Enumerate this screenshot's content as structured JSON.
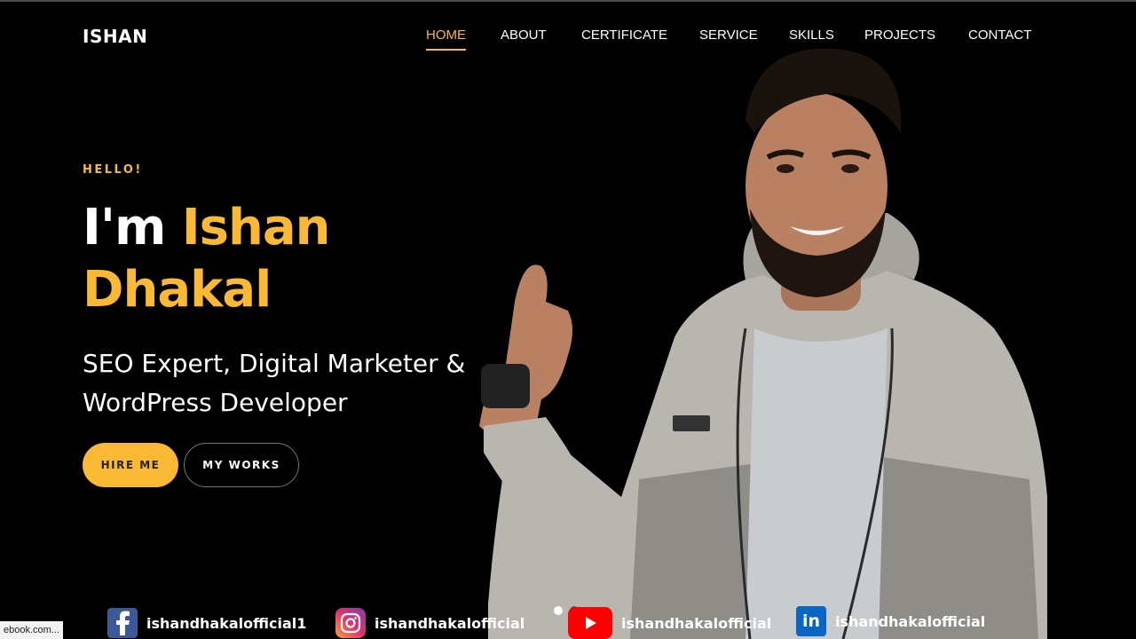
{
  "header": {
    "logo": "ISHAN",
    "nav": [
      {
        "label": "HOME",
        "active": true
      },
      {
        "label": "ABOUT",
        "active": false
      },
      {
        "label": "CERTIFICATE",
        "active": false
      },
      {
        "label": "SERVICE",
        "active": false
      },
      {
        "label": "SKILLS",
        "active": false
      },
      {
        "label": "PROJECTS",
        "active": false
      },
      {
        "label": "CONTACT",
        "active": false
      }
    ]
  },
  "hero": {
    "greeting": "HELLO!",
    "name_prefix": "I'm",
    "first_name": "Ishan",
    "last_name": "Dhakal",
    "subtitle_line1": "SEO Expert, Digital Marketer &",
    "subtitle_line2": "WordPress Developer",
    "hire_button": "HIRE ME",
    "works_button": "MY WORKS"
  },
  "social": {
    "facebook": "ishandhakalofficial1",
    "instagram": "ishandhakalofficial",
    "youtube": "ishandhakalofficial",
    "linkedin": "ishandhakalofficial"
  },
  "status_bar": {
    "url": "ebook.com..."
  },
  "colors": {
    "accent": "#f9b934",
    "background": "#000000",
    "text": "#ffffff"
  }
}
